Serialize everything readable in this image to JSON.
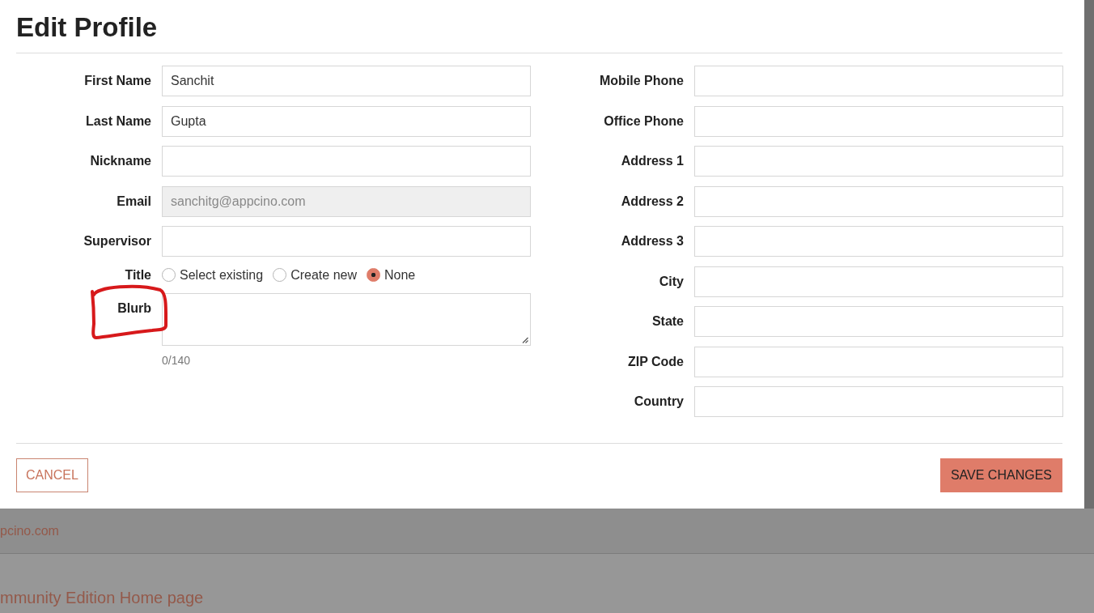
{
  "dialog": {
    "title": "Edit Profile"
  },
  "left_fields": [
    {
      "label": "First Name",
      "kind": "text",
      "value": "Sanchit",
      "disabled": false
    },
    {
      "label": "Last Name",
      "kind": "text",
      "value": "Gupta",
      "disabled": false
    },
    {
      "label": "Nickname",
      "kind": "text",
      "disabled": false
    },
    {
      "label": "Email",
      "kind": "text",
      "value": "sanchitg@appcino.com",
      "disabled": true
    },
    {
      "label": "Supervisor",
      "kind": "text",
      "disabled": false
    },
    {
      "label": "Title",
      "kind": "radio",
      "options": [
        {
          "label": "Select existing",
          "selected": false
        },
        {
          "label": "Create new",
          "selected": false
        },
        {
          "label": "None",
          "selected": true
        }
      ]
    },
    {
      "label": "Blurb",
      "kind": "textarea",
      "counter": "0/140"
    }
  ],
  "right_fields": [
    {
      "label": "Mobile Phone"
    },
    {
      "label": "Office Phone"
    },
    {
      "label": "Address 1"
    },
    {
      "label": "Address 2"
    },
    {
      "label": "Address 3"
    },
    {
      "label": "City"
    },
    {
      "label": "State"
    },
    {
      "label": "ZIP Code"
    },
    {
      "label": "Country"
    }
  ],
  "buttons": [
    {
      "label": "CANCEL",
      "kind": "outline"
    },
    {
      "label": "SAVE CHANGES",
      "kind": "primary"
    }
  ],
  "background_page": {
    "email": "pcino.com",
    "link": "mmunity Edition Home page"
  }
}
